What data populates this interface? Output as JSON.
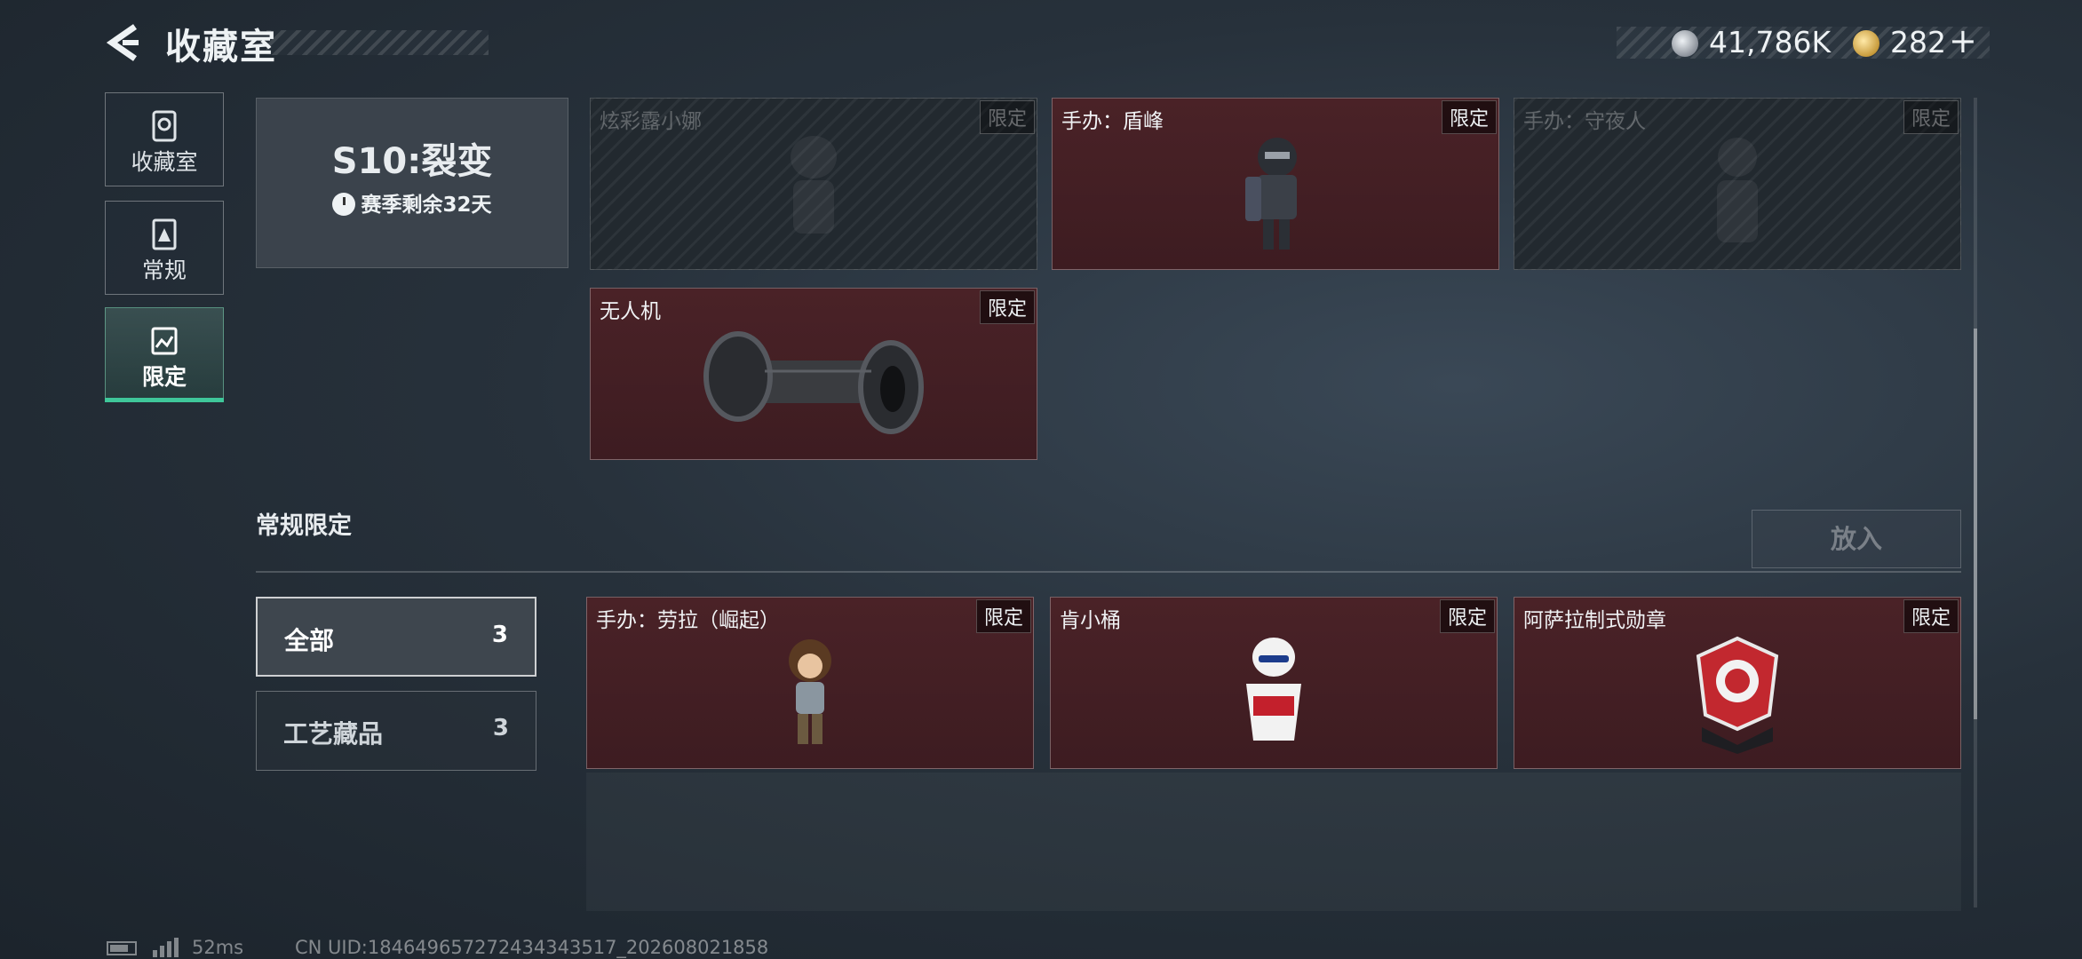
{
  "header": {
    "title": "收藏室",
    "currency1_value": "41,786K",
    "currency2_value": "282",
    "currency2_plus": "+"
  },
  "sidebar": {
    "items": [
      {
        "label": "收藏室",
        "icon": "vault-icon"
      },
      {
        "label": "常规",
        "icon": "card-icon"
      },
      {
        "label": "限定",
        "icon": "image-icon",
        "active": true
      }
    ]
  },
  "season": {
    "title": "S10:裂变",
    "remaining": "赛季剩余32天"
  },
  "season_items": [
    {
      "name": "炫彩露小娜",
      "badge": "限定",
      "state": "locked"
    },
    {
      "name": "手办：盾峰",
      "badge": "限定",
      "state": "owned"
    },
    {
      "name": "手办：守夜人",
      "badge": "限定",
      "state": "locked"
    },
    {
      "name": "无人机",
      "badge": "限定",
      "state": "owned"
    }
  ],
  "regular": {
    "section_title": "常规限定",
    "put_button": "放入",
    "filters": [
      {
        "label": "全部",
        "count": "3",
        "selected": true
      },
      {
        "label": "工艺藏品",
        "count": "3"
      }
    ],
    "items": [
      {
        "name": "手办：劳拉（崛起）",
        "badge": "限定"
      },
      {
        "name": "肯小桶",
        "badge": "限定"
      },
      {
        "name": "阿萨拉制式勋章",
        "badge": "限定"
      }
    ]
  },
  "status": {
    "ping": "52ms",
    "uid": "CN UID:1846496572724343435​17_202608021858"
  },
  "colors": {
    "accent": "#3fc79a",
    "card_active": "#4a2227"
  }
}
